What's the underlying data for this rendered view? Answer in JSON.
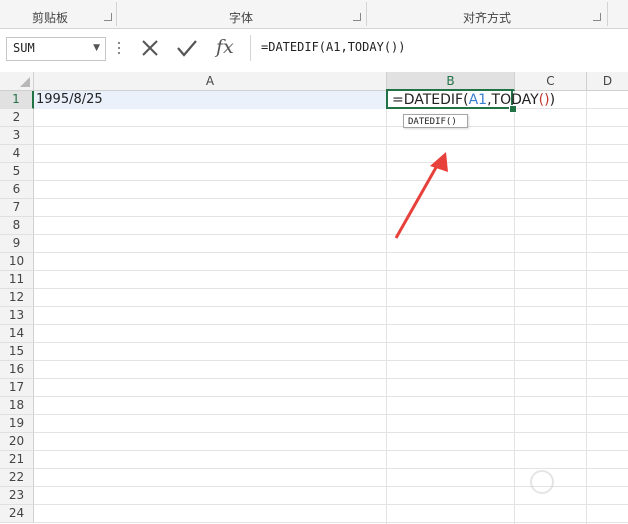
{
  "ribbon": {
    "clipboard_label": "剪贴板",
    "font_label": "字体",
    "alignment_label": "对齐方式"
  },
  "formula_bar": {
    "name_box_value": "SUM",
    "formula_text": "=DATEDIF(A1,TODAY())",
    "cancel_icon": "x-icon",
    "enter_icon": "check-icon",
    "fx_label": "fx"
  },
  "sheet": {
    "columns": [
      "A",
      "B",
      "C",
      "D"
    ],
    "active_column": "B",
    "rows": [
      "1",
      "2",
      "3",
      "4",
      "5",
      "6",
      "7",
      "8",
      "9",
      "10",
      "11",
      "12",
      "13",
      "14",
      "15",
      "16",
      "17",
      "18",
      "19",
      "20",
      "21",
      "22",
      "23",
      "24"
    ],
    "active_row": "1",
    "cells": {
      "A1": "1995/8/25",
      "B1_parts": {
        "prefix": "=DATEDIF(",
        "ref": "A1",
        "mid": ",TODAY",
        "paren": "()",
        "close": ")"
      }
    },
    "tooltip": "DATEDIF()"
  },
  "colors": {
    "accent": "#217346",
    "selection_fill": "#eaf1fb",
    "ref_color": "#3b7fd0",
    "paren_color": "#c0392b",
    "arrow": "#e8403a"
  }
}
